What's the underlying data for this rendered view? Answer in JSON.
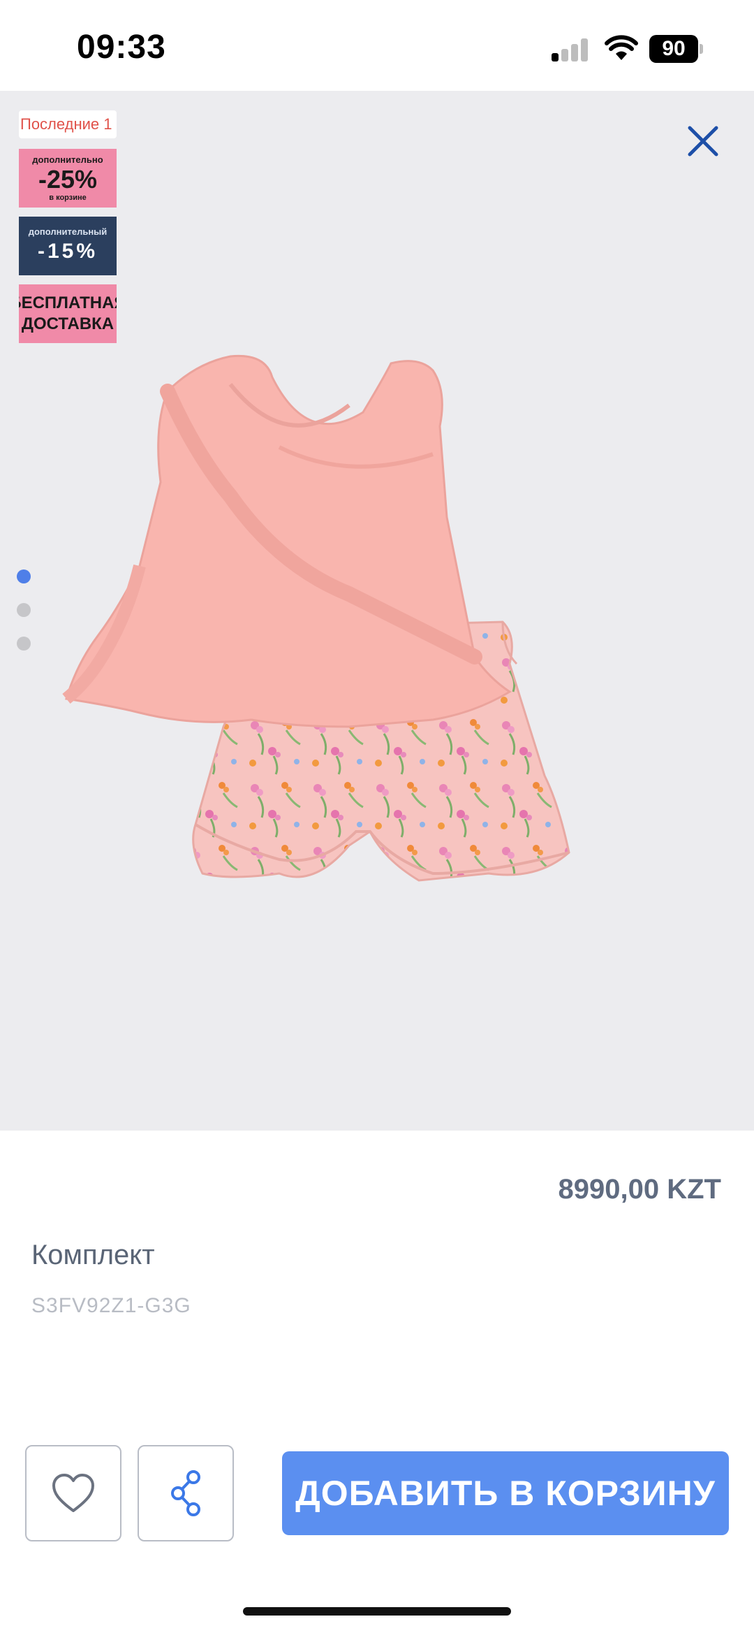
{
  "status_bar": {
    "time": "09:33",
    "battery_level": "90"
  },
  "gallery": {
    "promos": {
      "recent_label": "Последние 1",
      "extra_25": {
        "top": "дополнительно",
        "value": "-25%",
        "side": "в корзине"
      },
      "extra_15": {
        "top": "дополнительный",
        "value": "-15%"
      },
      "free_delivery": {
        "line1": "БЕСПЛАТНАЯ",
        "line2": "ДОСТАВКА"
      }
    },
    "total_images": 3,
    "active_image": 1,
    "icons": [
      "close-icon",
      "chevron-up-icon"
    ]
  },
  "product": {
    "price": "8990,00 KZT",
    "name": "Комплект",
    "sku": "S3FV92Z1-G3G"
  },
  "actions": {
    "favorite_icon": "heart-icon",
    "share_icon": "share-icon",
    "add_to_cart_label": "ДОБАВИТЬ В КОРЗИНУ"
  },
  "colors": {
    "accent": "#5b8ff0",
    "close_icon": "#1d4fa8",
    "gallery_bg": "#ececef",
    "price_text": "#5f6b80"
  }
}
